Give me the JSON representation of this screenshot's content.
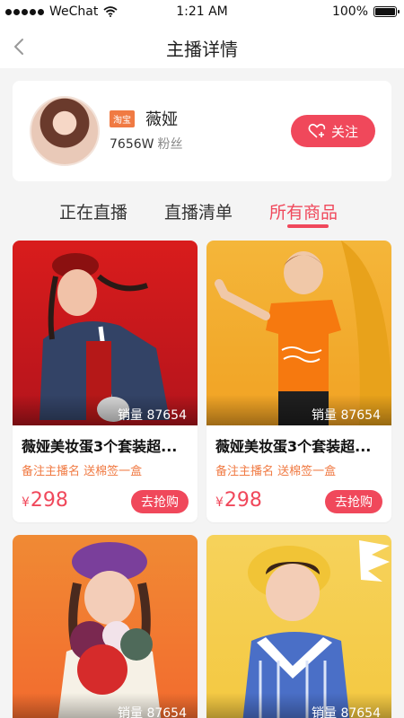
{
  "status": {
    "carrier": "WeChat",
    "time": "1:21 AM",
    "battery": "100%"
  },
  "nav": {
    "title": "主播详情"
  },
  "profile": {
    "platform": "淘宝",
    "name": "薇娅",
    "fans_count": "7656W",
    "fans_label": "粉丝",
    "follow_label": "关注"
  },
  "tabs": [
    {
      "label": "正在直播"
    },
    {
      "label": "直播清单"
    },
    {
      "label": "所有商品"
    }
  ],
  "products": [
    {
      "sales": "销量 87654",
      "title": "薇娅美妆蛋3个套装超...",
      "subtitle": "备注主播名 送棉签一盒",
      "price_symbol": "¥",
      "price": "298",
      "button": "去抢购"
    },
    {
      "sales": "销量 87654",
      "title": "薇娅美妆蛋3个套装超...",
      "subtitle": "备注主播名 送棉签一盒",
      "price_symbol": "¥",
      "price": "298",
      "button": "去抢购"
    },
    {
      "sales": "销量 87654"
    },
    {
      "sales": "销量 87654"
    }
  ],
  "colors": {
    "accent": "#f0485b",
    "tag": "#f07a43",
    "background": "#f4f4f4"
  }
}
